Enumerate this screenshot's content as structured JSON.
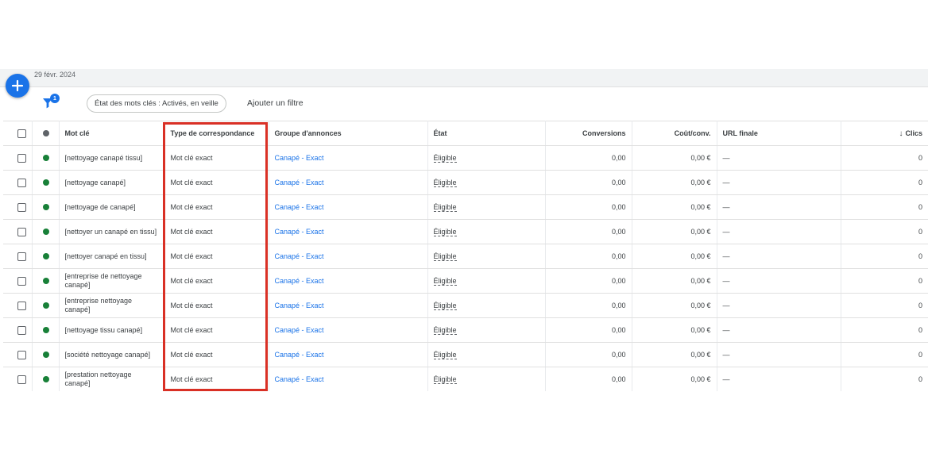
{
  "header": {
    "date": "29 févr. 2024",
    "filter_badge": "1",
    "filter_chip": "État des mots clés : Activés, en veille",
    "add_filter": "Ajouter un filtre"
  },
  "columns": {
    "keyword": "Mot clé",
    "match_type": "Type de correspondance",
    "ad_group": "Groupe d'annonces",
    "status": "État",
    "conversions": "Conversions",
    "cost_conv": "Coût/conv.",
    "final_url": "URL finale",
    "clicks": "Clics",
    "sort_arrow": "↓"
  },
  "rows": [
    {
      "keyword": "[nettoyage canapé tissu]",
      "match_type": "Mot clé exact",
      "ad_group": "Canapé - Exact",
      "status": "Éligible",
      "conversions": "0,00",
      "cost_conv": "0,00 €",
      "final_url": "—",
      "clicks": "0"
    },
    {
      "keyword": "[nettoyage canapé]",
      "match_type": "Mot clé exact",
      "ad_group": "Canapé - Exact",
      "status": "Éligible",
      "conversions": "0,00",
      "cost_conv": "0,00 €",
      "final_url": "—",
      "clicks": "0"
    },
    {
      "keyword": "[nettoyage de canapé]",
      "match_type": "Mot clé exact",
      "ad_group": "Canapé - Exact",
      "status": "Éligible",
      "conversions": "0,00",
      "cost_conv": "0,00 €",
      "final_url": "—",
      "clicks": "0"
    },
    {
      "keyword": "[nettoyer un canapé en tissu]",
      "match_type": "Mot clé exact",
      "ad_group": "Canapé - Exact",
      "status": "Éligible",
      "conversions": "0,00",
      "cost_conv": "0,00 €",
      "final_url": "—",
      "clicks": "0"
    },
    {
      "keyword": "[nettoyer canapé en tissu]",
      "match_type": "Mot clé exact",
      "ad_group": "Canapé - Exact",
      "status": "Éligible",
      "conversions": "0,00",
      "cost_conv": "0,00 €",
      "final_url": "—",
      "clicks": "0"
    },
    {
      "keyword": "[entreprise de nettoyage canapé]",
      "match_type": "Mot clé exact",
      "ad_group": "Canapé - Exact",
      "status": "Éligible",
      "conversions": "0,00",
      "cost_conv": "0,00 €",
      "final_url": "—",
      "clicks": "0"
    },
    {
      "keyword": "[entreprise nettoyage canapé]",
      "match_type": "Mot clé exact",
      "ad_group": "Canapé - Exact",
      "status": "Éligible",
      "conversions": "0,00",
      "cost_conv": "0,00 €",
      "final_url": "—",
      "clicks": "0"
    },
    {
      "keyword": "[nettoyage tissu canapé]",
      "match_type": "Mot clé exact",
      "ad_group": "Canapé - Exact",
      "status": "Éligible",
      "conversions": "0,00",
      "cost_conv": "0,00 €",
      "final_url": "—",
      "clicks": "0"
    },
    {
      "keyword": "[société nettoyage canapé]",
      "match_type": "Mot clé exact",
      "ad_group": "Canapé - Exact",
      "status": "Éligible",
      "conversions": "0,00",
      "cost_conv": "0,00 €",
      "final_url": "—",
      "clicks": "0"
    },
    {
      "keyword": "[prestation nettoyage canapé]",
      "match_type": "Mot clé exact",
      "ad_group": "Canapé - Exact",
      "status": "Éligible",
      "conversions": "0,00",
      "cost_conv": "0,00 €",
      "final_url": "—",
      "clicks": "0"
    }
  ],
  "colors": {
    "accent": "#1a73e8",
    "status_enabled": "#188038",
    "highlight": "#d93025"
  },
  "icons": {
    "add": "plus-icon",
    "filter": "filter-icon",
    "sort": "arrow-down-icon"
  }
}
